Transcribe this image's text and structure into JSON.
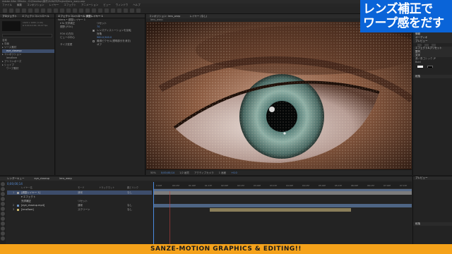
{
  "window": {
    "title": "Adobe After Effects - D:\\Desktop\\案件\\SANZE\\Project\\lens_warp.aep"
  },
  "menu": [
    "ファイル",
    "編集",
    "コンポジション",
    "レイヤー",
    "エフェクト",
    "アニメーション",
    "ビュー",
    "ウィンドウ",
    "ヘルプ"
  ],
  "project": {
    "tab": "プロジェクト",
    "tab2": "エフェクトコントロール",
    "info_line1": "1920 x 1080 (1.00)",
    "info_line2": "Δ 0;00;10;00, 29.97 fps",
    "items": [
      {
        "label": "名前",
        "sel": false,
        "indent": false
      },
      {
        "label": "▸ 平面",
        "sel": false,
        "indent": false
      },
      {
        "label": "▸ ソース素材",
        "sel": false,
        "indent": false
      },
      {
        "label": "eye_closeup",
        "sel": true,
        "indent": true
      },
      {
        "label": "▸ コンポジション",
        "sel": false,
        "indent": false
      },
      {
        "label": "lensflare",
        "sel": false,
        "indent": true
      },
      {
        "label": "▸ プリコンポーズ",
        "sel": false,
        "indent": false
      },
      {
        "label": "▸ シェイプ",
        "sel": false,
        "indent": false
      },
      {
        "label": "ワープ素材",
        "sel": false,
        "indent": true
      }
    ]
  },
  "effects": {
    "tab": "エフェクトコントロール 調整レイヤー 1",
    "header": "fxlens • 調整レイヤー 1",
    "rows": [
      {
        "key": "▾ fx 光学補正",
        "value": "リセット",
        "white": true
      },
      {
        "key": "視野 (FOV)",
        "value": "70",
        "white": false
      },
      {
        "key": "レンズディストーションを反転",
        "value": "",
        "check": true,
        "on": true
      },
      {
        "key": "FOV の方向",
        "value": "対角",
        "white": true
      },
      {
        "key": "ビューの中心",
        "value": "960.0,540.0",
        "white": false
      },
      {
        "key": "最適ピクセル(透明部分を消去)",
        "value": "",
        "check": true,
        "on": false
      },
      {
        "key": "サイズ変更",
        "value": "オフ",
        "white": true
      }
    ]
  },
  "viewer": {
    "tab": "コンポジション: lens_warp",
    "tab2": "レイヤー (なし)",
    "sub": "lens_warp",
    "zoom": "50%",
    "timecode": "0;00;00;14",
    "quality": "1/2 画質",
    "camera": "アクティブカメラ",
    "views": "1 画面",
    "offset": "+0.0"
  },
  "overlay": {
    "line1": "レンズ補正で",
    "line2": "ワープ感をだす",
    "color": "#0a64d8"
  },
  "rightpanel": {
    "head1": "情報",
    "head2": "オーディオ",
    "head3": "プレビュー",
    "head4": "エフェクト&プリセット",
    "head5": "整列",
    "head6": "文字",
    "font": "源ノ角ゴシック JP",
    "style": "Bold",
    "head7": "段落"
  },
  "timeline": {
    "tabs": [
      "レンダーキュー",
      "eye_closeup",
      "lens_warp"
    ],
    "timecode": "0;00;00;14",
    "columns": {
      "layer_name": "レイヤー名",
      "mode": "モード",
      "trkmat": "トラックマット",
      "parent": "親とリンク"
    },
    "layers": [
      {
        "num": "1",
        "name": "[調整レイヤー 1]",
        "mode": "通常",
        "parent": "なし",
        "color": "#a0a0a0",
        "sel": true
      },
      {
        "num": "",
        "name": "▾ エフェクト",
        "mode": "",
        "parent": "",
        "color": "#232323",
        "sel": false
      },
      {
        "num": "",
        "name": "光学補正",
        "mode": "リセット",
        "parent": "",
        "color": "#232323",
        "sel": false
      },
      {
        "num": "2",
        "name": "[eye_closeup.mp4]",
        "mode": "通常",
        "parent": "なし",
        "color": "#6a8fbf",
        "sel": false
      },
      {
        "num": "3",
        "name": "[lensflare]",
        "mode": "スクリーン",
        "parent": "なし",
        "color": "#c9b46a",
        "sel": false
      }
    ],
    "ruler_ticks": [
      "0:00f",
      "00:15f",
      "01:00f",
      "01:15f",
      "02:00f",
      "02:15f",
      "03:00f",
      "03:15f",
      "04:00f",
      "04:15f",
      "05:00f",
      "05:15f",
      "06:00f",
      "06:15f",
      "07:00f",
      "07:15f"
    ],
    "right_head": "プレビュー",
    "right_label": "段落"
  },
  "footer": {
    "text": "SANZE-MOTION GRAPHICS & EDITING!!"
  }
}
